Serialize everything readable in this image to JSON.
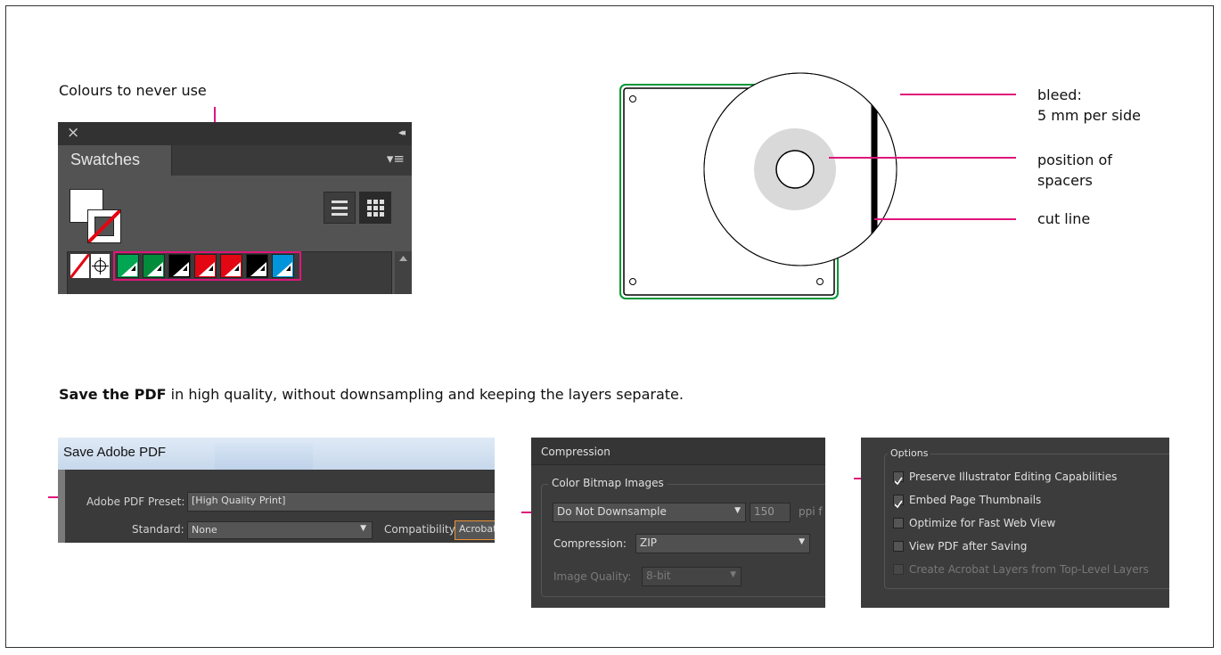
{
  "top_left": {
    "caption": "Colours to never use"
  },
  "swatches_panel": {
    "close_glyph": "×",
    "collapse_glyph": "◂◂",
    "tab_label": "Swatches",
    "menu_glyph": "▾≡",
    "swatch_colors": [
      "#00a651",
      "#008c3a",
      "#000000",
      "#e30613",
      "#e30613",
      "#000000",
      "#0095da"
    ]
  },
  "bleed_diagram": {
    "labels": {
      "bleed_line1": "bleed:",
      "bleed_line2": "5 mm per side",
      "spacers_line1": "position of",
      "spacers_line2": "spacers",
      "cut_line": "cut line"
    },
    "colors": {
      "bleed": "#009639",
      "cut": "#000000",
      "leader": "#e0157a",
      "spacer": "#d9d9d9"
    }
  },
  "instruction": {
    "bold": "Save the PDF",
    "rest": " in high quality, without downsampling and keeping the layers separate."
  },
  "save_pdf_dialog": {
    "title": "Save Adobe PDF",
    "preset_label": "Adobe PDF Preset:",
    "preset_value": "[High Quality Print]",
    "standard_label": "Standard:",
    "standard_value": "None",
    "compat_label": "Compatibility:",
    "compat_value": "Acrobat"
  },
  "compression_dialog": {
    "header": "Compression",
    "group": "Color Bitmap Images",
    "downsample_value": "Do Not Downsample",
    "ppi_value": "150",
    "ppi_unit": "ppi f",
    "compression_label": "Compression:",
    "compression_value": "ZIP",
    "quality_label": "Image Quality:",
    "quality_value": "8-bit"
  },
  "options_dialog": {
    "header": "Options",
    "items": [
      {
        "label": "Preserve Illustrator Editing Capabilities",
        "checked": true,
        "enabled": true
      },
      {
        "label": "Embed Page Thumbnails",
        "checked": true,
        "enabled": true
      },
      {
        "label": "Optimize for Fast Web View",
        "checked": false,
        "enabled": true
      },
      {
        "label": "View PDF after Saving",
        "checked": false,
        "enabled": true
      },
      {
        "label": "Create Acrobat Layers from Top-Level Layers",
        "checked": false,
        "enabled": false
      }
    ]
  },
  "accent": "#e0157a"
}
